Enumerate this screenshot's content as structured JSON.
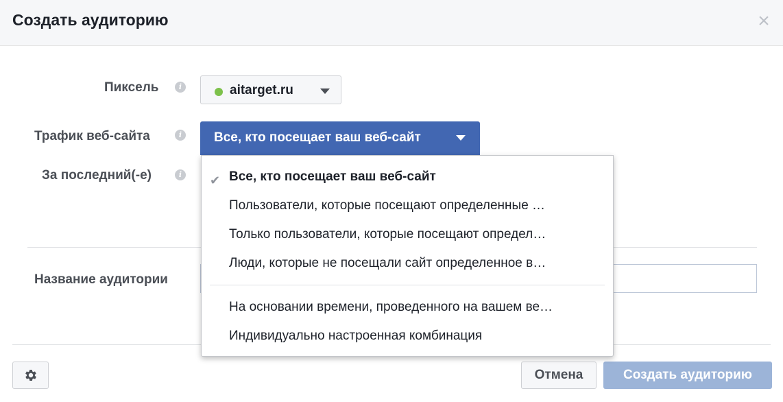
{
  "dialog": {
    "title": "Создать аудиторию",
    "close_icon": "×"
  },
  "form": {
    "pixel_label": "Пиксель",
    "pixel_value": "aitarget.ru",
    "pixel_status_color": "#7dc14b",
    "traffic_label": "Трафик веб-сайта",
    "traffic_value": "Все, кто посещает ваш веб-сайт",
    "period_label": "За последний(-е)",
    "name_label": "Название аудитории",
    "info_icon": "i"
  },
  "dropdown": {
    "check_icon": "✔",
    "items": [
      "Все, кто посещает ваш веб-сайт",
      "Пользователи, которые посещают определенные …",
      "Только пользователи, которые посещают определ…",
      "Люди, которые не посещали сайт определенное в…",
      "На основании времени, проведенного на вашем ве…",
      "Индивидуально настроенная комбинация"
    ]
  },
  "footer": {
    "cancel_label": "Отмена",
    "create_label": "Создать аудиторию"
  },
  "colors": {
    "primary_blue": "#4267b2",
    "disabled_blue": "#9cb4d8"
  }
}
